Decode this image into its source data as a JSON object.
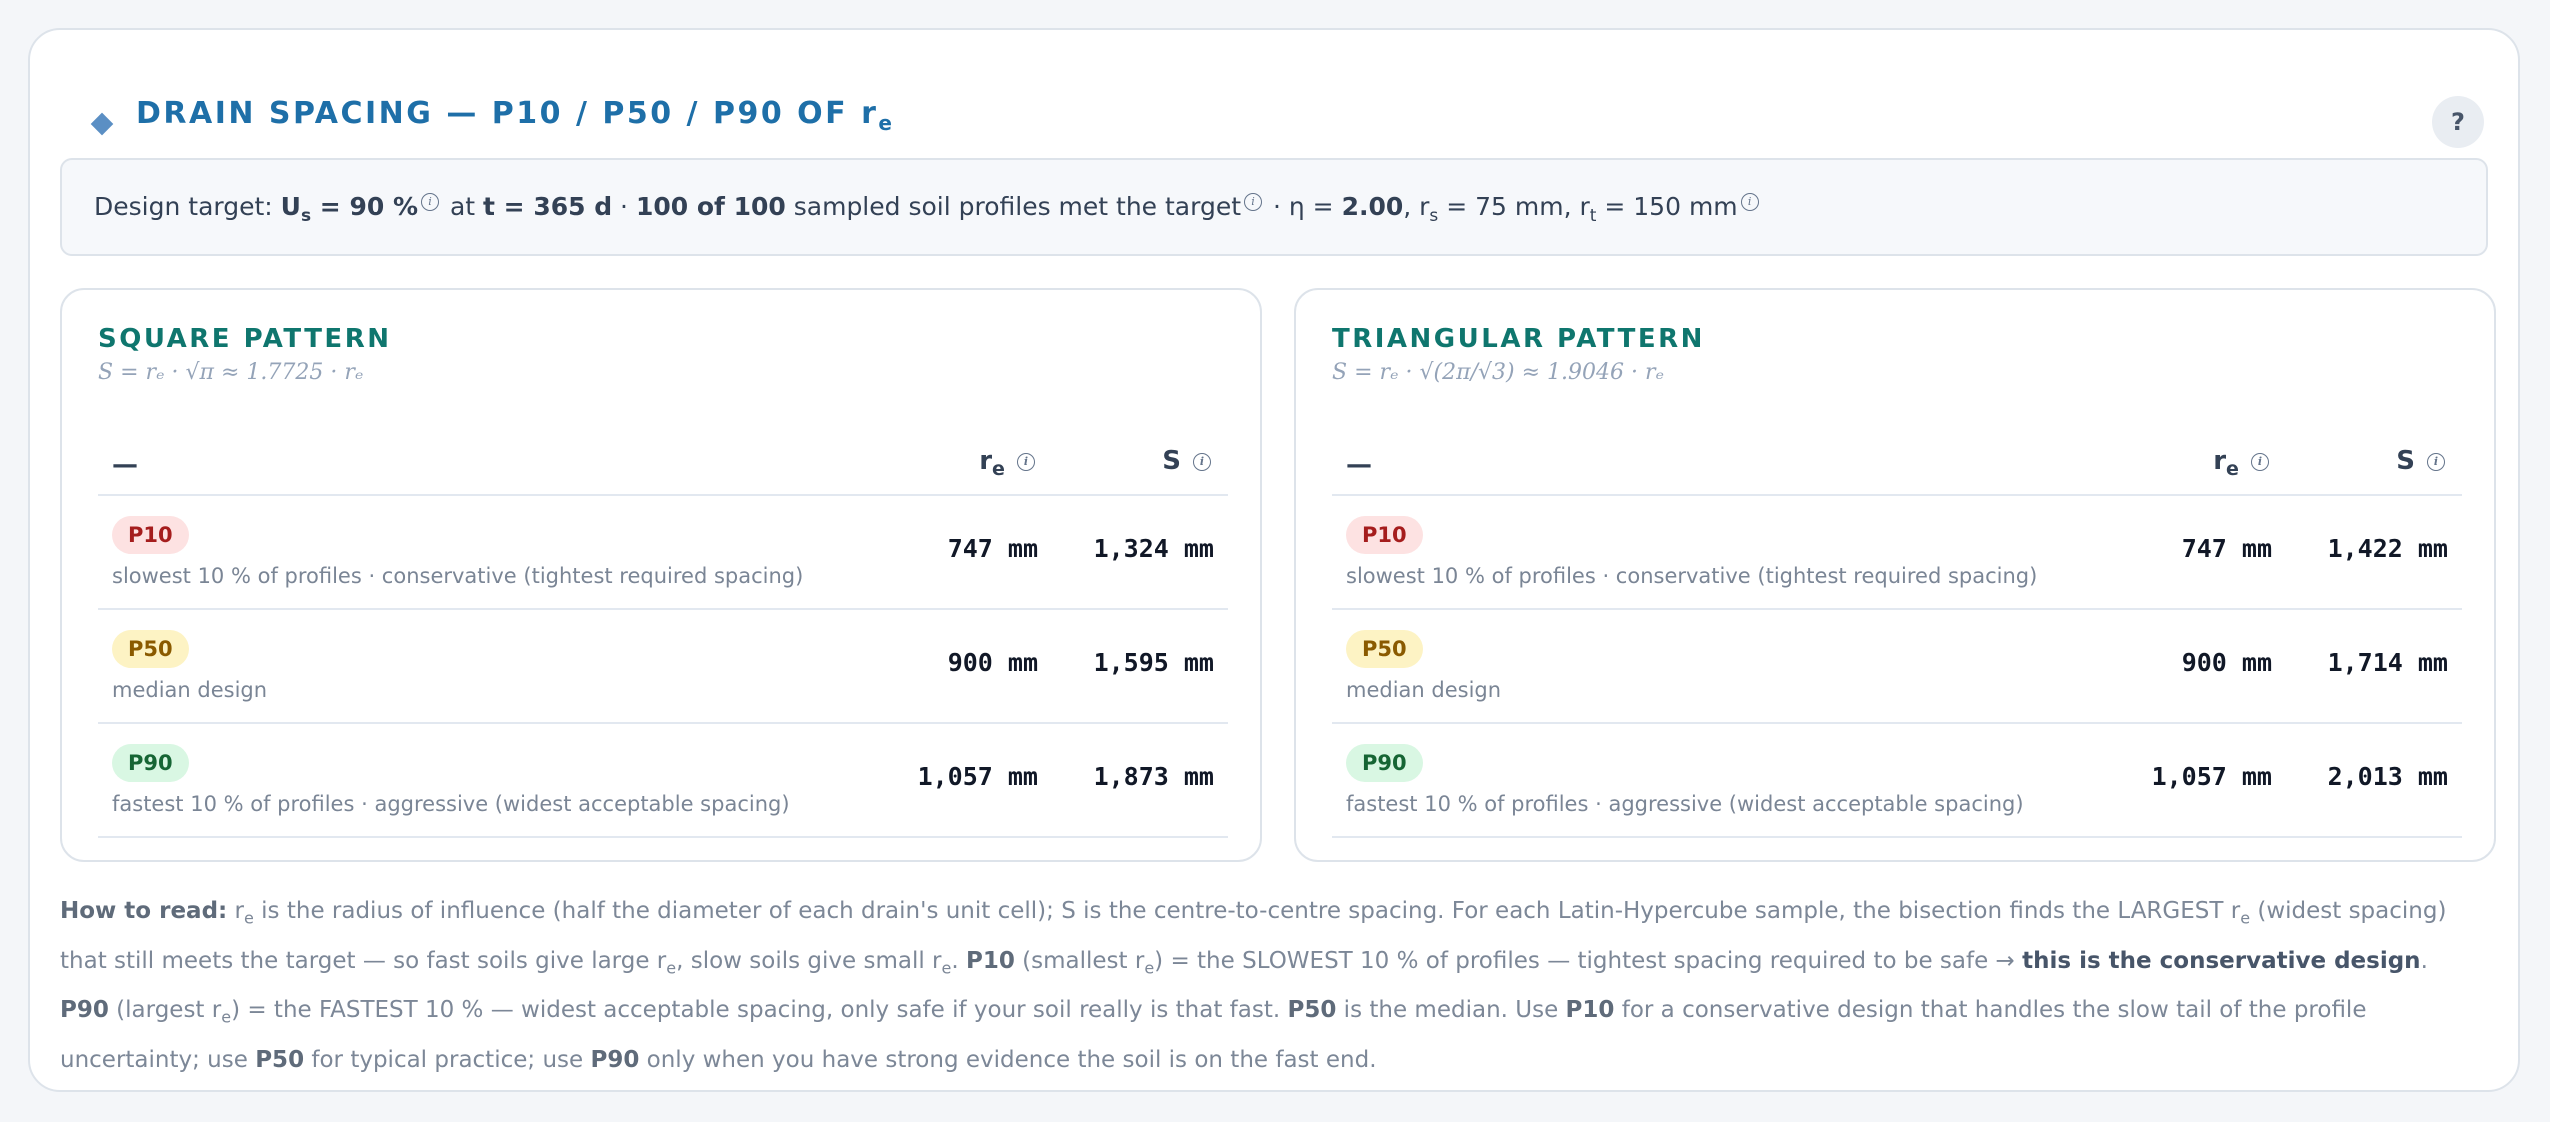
{
  "header": {
    "title_main": "DRAIN SPACING — P10 / P50 / P90 OF r",
    "title_sub": "e",
    "help_label": "?",
    "info_glyph": "i"
  },
  "target": {
    "p1": "Design target: ",
    "us_main": "U",
    "us_sub": "s",
    "us_val": " = 90 %",
    "p2": " at ",
    "t_val": "t = 365 d",
    "p3": " · ",
    "profiles": "100 of 100",
    "p4": " sampled soil profiles met the target",
    "p5": " · η = ",
    "eta": "2.00",
    "p6": ", r",
    "rs_sub": "s",
    "p7": " = 75 mm, r",
    "rt_sub": "t",
    "p8": " = 150 mm"
  },
  "panels": [
    {
      "title": "SQUARE PATTERN",
      "formula": "S = rₑ · √π ≈ 1.7725 · rₑ",
      "col_dash": "—",
      "col_re_main": "r",
      "col_re_sub": "e",
      "col_s": "S",
      "rows": [
        {
          "badge": "P10",
          "desc": "slowest 10 % of profiles · conservative (tightest required spacing)",
          "re": "747 mm",
          "s": "1,324 mm"
        },
        {
          "badge": "P50",
          "desc": "median design",
          "re": "900 mm",
          "s": "1,595 mm"
        },
        {
          "badge": "P90",
          "desc": "fastest 10 % of profiles · aggressive (widest acceptable spacing)",
          "re": "1,057 mm",
          "s": "1,873 mm"
        }
      ]
    },
    {
      "title": "TRIANGULAR PATTERN",
      "formula": "S = rₑ · √(2π/√3) ≈ 1.9046 · rₑ",
      "col_dash": "—",
      "col_re_main": "r",
      "col_re_sub": "e",
      "col_s": "S",
      "rows": [
        {
          "badge": "P10",
          "desc": "slowest 10 % of profiles · conservative (tightest required spacing)",
          "re": "747 mm",
          "s": "1,422 mm"
        },
        {
          "badge": "P50",
          "desc": "median design",
          "re": "900 mm",
          "s": "1,714 mm"
        },
        {
          "badge": "P90",
          "desc": "fastest 10 % of profiles · aggressive (widest acceptable spacing)",
          "re": "1,057 mm",
          "s": "2,013 mm"
        }
      ]
    }
  ],
  "howto": {
    "lead": "How to read:",
    "t1": " r",
    "t1s": "e",
    "t2": " is the radius of influence (half the diameter of each drain's unit cell); S is the centre-to-centre spacing. For each Latin-Hypercube sample, the bisection finds the LARGEST r",
    "t2s": "e",
    "t3": " (widest spacing) that still meets the target — so fast soils give large r",
    "t3s": "e",
    "t4": ", slow soils give small r",
    "t4s": "e",
    "t5": ". ",
    "b_p10": "P10",
    "t6": " (smallest r",
    "t6s": "e",
    "t7": ") = the SLOWEST 10 % of profiles — tightest spacing required to be safe → ",
    "b_cons": "this is the conservative design",
    "t8": ". ",
    "b_p90": "P90",
    "t9": " (largest r",
    "t9s": "e",
    "t10": ") = the FASTEST 10 % — widest acceptable spacing, only safe if your soil really is that fast. ",
    "b_p50": "P50",
    "t11": " is the median. Use ",
    "b_p10b": "P10",
    "t12": " for a conservative design that handles the slow tail of the profile uncertainty; use ",
    "b_p50b": "P50",
    "t13": " for typical practice; use ",
    "b_p90b": "P90",
    "t14": " only when you have strong evidence the soil is on the fast end."
  }
}
